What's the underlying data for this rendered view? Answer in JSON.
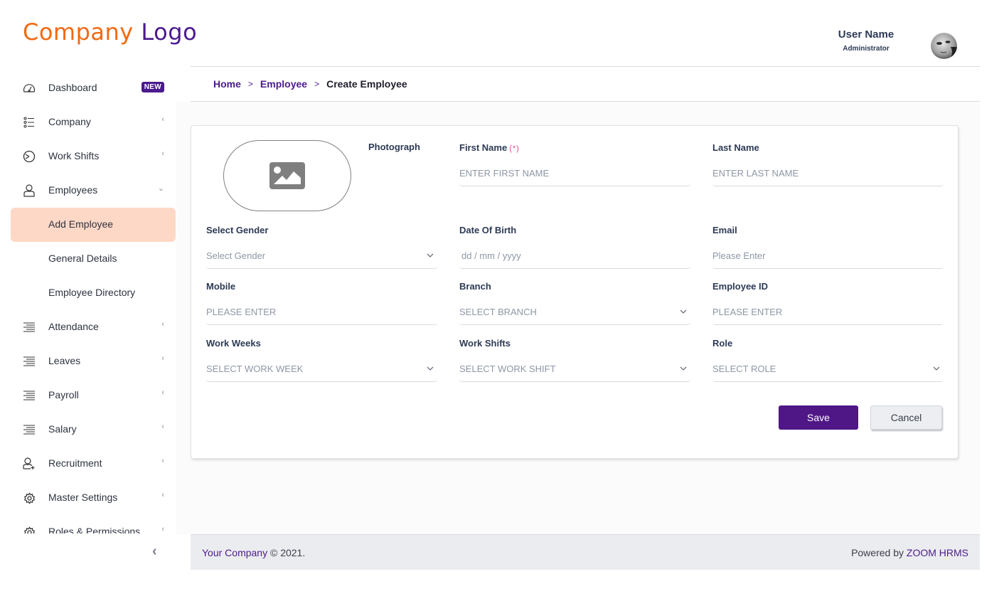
{
  "logo": {
    "part1": "Company",
    "part2": "Logo"
  },
  "user": {
    "name": "User Name",
    "role": "Administrator"
  },
  "sidebar": {
    "items": [
      {
        "label": "Dashboard",
        "icon": "dashboard-gauge-icon",
        "badge": "NEW"
      },
      {
        "label": "Company",
        "icon": "list-icon",
        "chevron": "‹"
      },
      {
        "label": "Work Shifts",
        "icon": "clock-icon",
        "chevron": "‹"
      },
      {
        "label": "Employees",
        "icon": "user-icon",
        "chevron": "⌄"
      },
      {
        "label": "Add Employee",
        "sub": true,
        "active": true
      },
      {
        "label": "General Details",
        "sub": true
      },
      {
        "label": "Employee Directory",
        "sub": true
      },
      {
        "label": "Attendance",
        "icon": "align-right-lines-icon",
        "chevron": "‹"
      },
      {
        "label": "Leaves",
        "icon": "align-right-lines-icon",
        "chevron": "‹"
      },
      {
        "label": "Payroll",
        "icon": "align-right-lines-icon",
        "chevron": "‹"
      },
      {
        "label": "Salary",
        "icon": "align-right-lines-icon",
        "chevron": "‹"
      },
      {
        "label": "Recruitment",
        "icon": "user-add-icon",
        "chevron": "‹"
      },
      {
        "label": "Master Settings",
        "icon": "gear-icon",
        "chevron": "‹"
      },
      {
        "label": "Roles & Permissions",
        "icon": "gear-icon",
        "chevron": "‹"
      }
    ],
    "collapse_glyph": "‹"
  },
  "breadcrumb": {
    "items": [
      "Home",
      "Employee",
      "Create Employee"
    ],
    "separator": ">"
  },
  "form": {
    "photo_label": "Photograph",
    "required_marker": "(*)",
    "fields": [
      {
        "label": "First Name",
        "placeholder": "ENTER FIRST NAME",
        "type": "text",
        "required": true
      },
      {
        "label": "Last Name",
        "placeholder": "ENTER LAST NAME",
        "type": "text"
      },
      {
        "label": "Select Gender",
        "placeholder": "Select Gender",
        "type": "select"
      },
      {
        "label": "Date Of Birth",
        "placeholder": "dd / mm / yyyy",
        "type": "date"
      },
      {
        "label": "Email",
        "placeholder": "Please Enter",
        "type": "text"
      },
      {
        "label": "Mobile",
        "placeholder": "PLEASE ENTER",
        "type": "text"
      },
      {
        "label": "Branch",
        "placeholder": "SELECT BRANCH",
        "type": "select"
      },
      {
        "label": "Employee ID",
        "placeholder": "PLEASE ENTER",
        "type": "text"
      },
      {
        "label": "Work Weeks",
        "placeholder": "SELECT WORK WEEK",
        "type": "select"
      },
      {
        "label": "Work Shifts",
        "placeholder": "SELECT WORK SHIFT",
        "type": "select"
      },
      {
        "label": "Role",
        "placeholder": "SELECT ROLE",
        "type": "select"
      }
    ],
    "save_label": "Save",
    "cancel_label": "Cancel"
  },
  "footer": {
    "company": "Your Company",
    "copyright": " © 2021.",
    "powered_prefix": "Powered by ",
    "powered_brand": "ZOOM HRMS"
  },
  "colors": {
    "brand_purple": "#4b1a8f",
    "brand_orange": "#f26a12",
    "active_item_bg": "#fed8c6",
    "required_pink": "#e4468f"
  }
}
